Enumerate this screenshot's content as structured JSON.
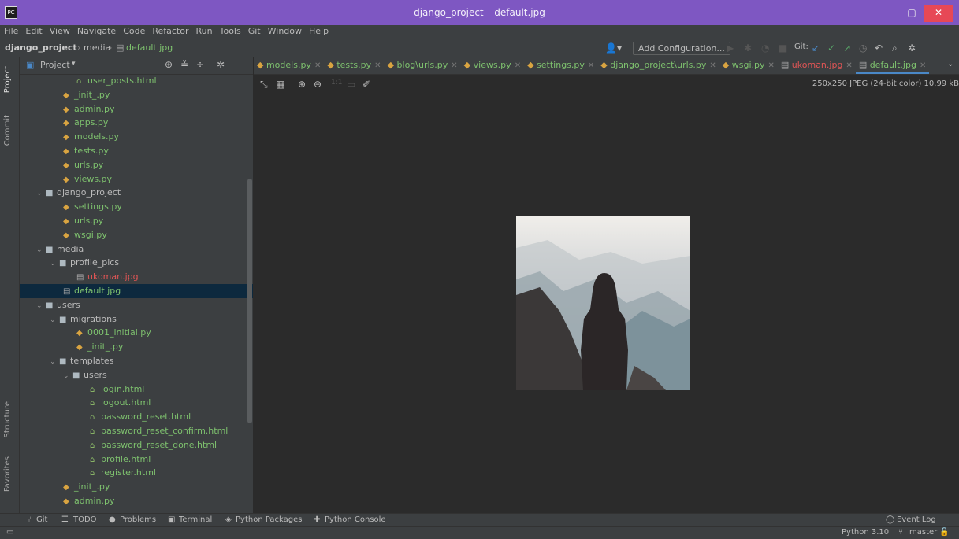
{
  "window": {
    "title": "django_project – default.jpg",
    "minimize": "–",
    "maximize": "▢",
    "close": "✕"
  },
  "menu": [
    "File",
    "Edit",
    "View",
    "Navigate",
    "Code",
    "Refactor",
    "Run",
    "Tools",
    "Git",
    "Window",
    "Help"
  ],
  "breadcrumb": {
    "project": "django_project",
    "folder": "media",
    "file": "default.jpg"
  },
  "toolbar": {
    "add_configuration": "Add Configuration...",
    "git_label": "Git:"
  },
  "side_tabs": {
    "project": "Project",
    "commit": "Commit",
    "structure": "Structure",
    "favorites": "Favorites"
  },
  "project_panel": {
    "title": "Project"
  },
  "tree": [
    {
      "label": "user_posts.html",
      "type": "html",
      "indent": 4
    },
    {
      "label": "_init_.py",
      "type": "py",
      "indent": 3
    },
    {
      "label": "admin.py",
      "type": "py",
      "indent": 3
    },
    {
      "label": "apps.py",
      "type": "py",
      "indent": 3
    },
    {
      "label": "models.py",
      "type": "py",
      "indent": 3
    },
    {
      "label": "tests.py",
      "type": "py",
      "indent": 3
    },
    {
      "label": "urls.py",
      "type": "py",
      "indent": 3
    },
    {
      "label": "views.py",
      "type": "py",
      "indent": 3
    },
    {
      "label": "django_project",
      "type": "folder",
      "indent": 1
    },
    {
      "label": "settings.py",
      "type": "py",
      "indent": 3
    },
    {
      "label": "urls.py",
      "type": "py",
      "indent": 3
    },
    {
      "label": "wsgi.py",
      "type": "py",
      "indent": 3
    },
    {
      "label": "media",
      "type": "folder",
      "indent": 1
    },
    {
      "label": "profile_pics",
      "type": "folder",
      "indent": 2
    },
    {
      "label": "ukoman.jpg",
      "type": "redimg",
      "indent": 4
    },
    {
      "label": "default.jpg",
      "type": "img",
      "indent": 3,
      "selected": true
    },
    {
      "label": "users",
      "type": "folder",
      "indent": 1
    },
    {
      "label": "migrations",
      "type": "folder",
      "indent": 2
    },
    {
      "label": "0001_initial.py",
      "type": "py",
      "indent": 4
    },
    {
      "label": "_init_.py",
      "type": "py",
      "indent": 4
    },
    {
      "label": "templates",
      "type": "folder",
      "indent": 2
    },
    {
      "label": "users",
      "type": "folder",
      "indent": 3
    },
    {
      "label": "login.html",
      "type": "html",
      "indent": 5
    },
    {
      "label": "logout.html",
      "type": "html",
      "indent": 5
    },
    {
      "label": "password_reset.html",
      "type": "html",
      "indent": 5
    },
    {
      "label": "password_reset_confirm.html",
      "type": "html",
      "indent": 5
    },
    {
      "label": "password_reset_done.html",
      "type": "html",
      "indent": 5
    },
    {
      "label": "profile.html",
      "type": "html",
      "indent": 5
    },
    {
      "label": "register.html",
      "type": "html",
      "indent": 5
    },
    {
      "label": "_init_.py",
      "type": "py",
      "indent": 3
    },
    {
      "label": "admin.py",
      "type": "py",
      "indent": 3
    }
  ],
  "tabs": [
    {
      "label": "models.py"
    },
    {
      "label": "tests.py"
    },
    {
      "label": "blog\\urls.py"
    },
    {
      "label": "views.py"
    },
    {
      "label": "settings.py"
    },
    {
      "label": "django_project\\urls.py"
    },
    {
      "label": "wsgi.py"
    },
    {
      "label": "ukoman.jpg",
      "red": true
    },
    {
      "label": "default.jpg",
      "active": true
    }
  ],
  "image_info": "250x250 JPEG (24-bit color) 10.99 kB",
  "bottom_tools": [
    "Git",
    "TODO",
    "Problems",
    "Terminal",
    "Python Packages",
    "Python Console"
  ],
  "event_log": "Event Log",
  "status": {
    "interpreter": "Python 3.10",
    "branch": "master"
  },
  "colors": {
    "titlebar": "#7e57c2",
    "panel": "#3c3f41",
    "editor": "#2b2b2b",
    "file_green": "#7ec16e",
    "file_red": "#e05555",
    "selection": "#0d293e"
  }
}
